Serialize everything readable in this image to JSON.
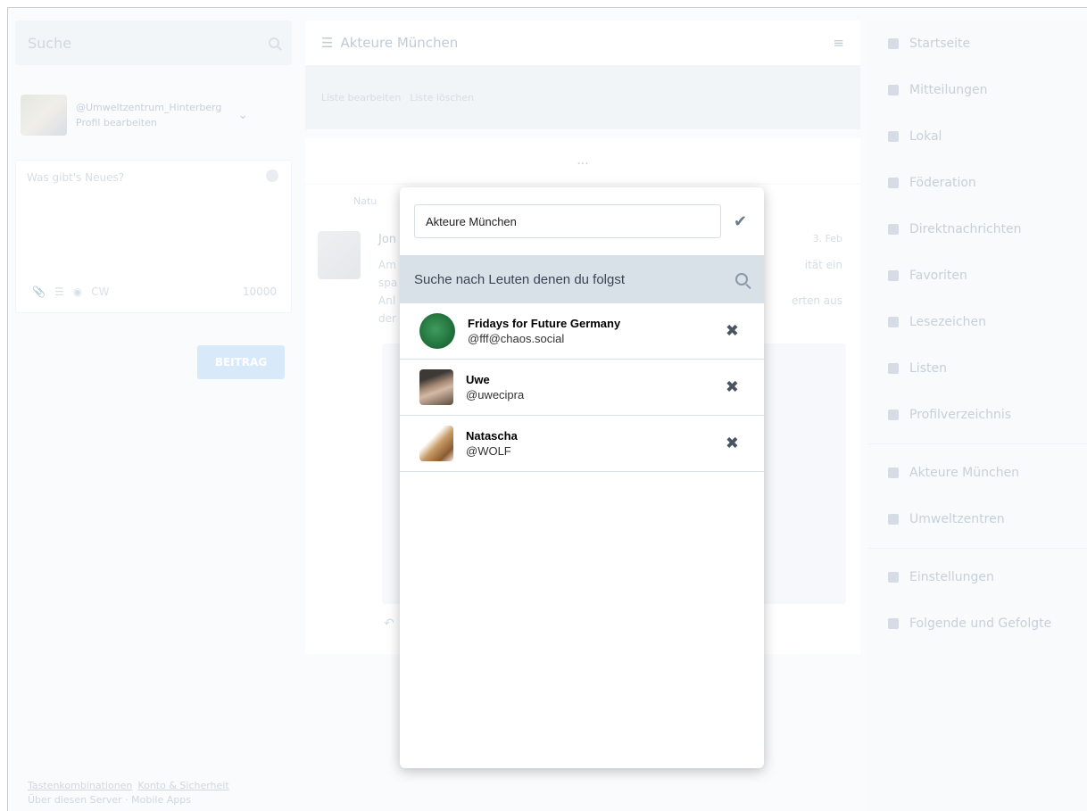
{
  "left": {
    "search_placeholder": "Suche",
    "profile": {
      "handle": "@Umweltzentrum_Hinterberg",
      "edit_link": "Profil bearbeiten"
    },
    "compose": {
      "placeholder": "Was gibt's Neues?",
      "cw": "CW",
      "char_count": "10000",
      "post_button": "BEITRAG"
    },
    "footer": {
      "link_1": "Tastenkombinationen",
      "link_2": "Konto & Sicherheit",
      "link_3": "Über diesen Server · Mobile Apps"
    }
  },
  "middle": {
    "column_title": "Akteure München",
    "edit_list": "Liste bearbeiten",
    "delete_list": "Liste löschen",
    "load_more": "...",
    "status": {
      "boost_label": "Natu",
      "author": "Jon",
      "date": "3. Feb",
      "body_line_1": "Am",
      "body_line_2": "spa",
      "body_line_3": "Anl",
      "body_line_4": "der",
      "body_right_1": "ität ein",
      "body_right_2": "erten aus"
    }
  },
  "right_nav": {
    "items": [
      {
        "label": "Startseite",
        "icon": "home-icon"
      },
      {
        "label": "Mitteilungen",
        "icon": "bell-icon"
      },
      {
        "label": "Lokal",
        "icon": "users-icon"
      },
      {
        "label": "Föderation",
        "icon": "globe-icon"
      },
      {
        "label": "Direktnachrichten",
        "icon": "envelope-icon"
      },
      {
        "label": "Favoriten",
        "icon": "star-icon"
      },
      {
        "label": "Lesezeichen",
        "icon": "bookmark-icon"
      },
      {
        "label": "Listen",
        "icon": "list-icon"
      },
      {
        "label": "Profilverzeichnis",
        "icon": "address-book-icon"
      }
    ],
    "lists": [
      {
        "label": "Akteure München",
        "icon": "list-icon"
      },
      {
        "label": "Umweltzentren",
        "icon": "list-icon"
      }
    ],
    "settings": [
      {
        "label": "Einstellungen",
        "icon": "gear-icon"
      },
      {
        "label": "Folgende und Gefolgte",
        "icon": "users-icon"
      }
    ]
  },
  "modal": {
    "title_value": "Akteure München",
    "search_placeholder": "Suche nach Leuten denen du folgst",
    "accounts": [
      {
        "display_name": "Fridays for Future Germany",
        "username": "@fff@chaos.social"
      },
      {
        "display_name": "Uwe",
        "username": "@uwecipra"
      },
      {
        "display_name": "Natascha",
        "username": "@WOLF"
      }
    ],
    "colors": {
      "search_strip": "#d9e1e8",
      "modal_bg": "#ffffff"
    }
  }
}
